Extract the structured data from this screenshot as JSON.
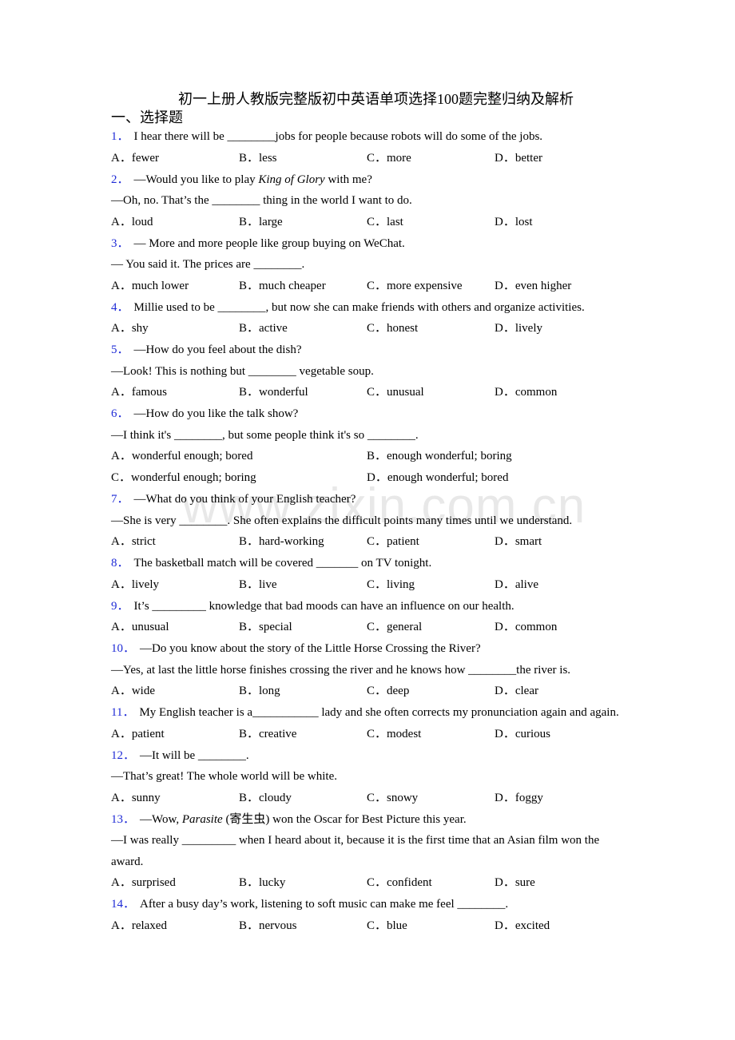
{
  "document": {
    "title": "初一上册人教版完整版初中英语单项选择100题完整归纳及解析",
    "section_heading": "一、选择题",
    "watermark": "www.zixin.com.cn",
    "accent_color": "#1f2bd6"
  },
  "questions": [
    {
      "number": "1．",
      "lines": [
        "I hear there will be ________jobs for people because robots will do some of the jobs."
      ],
      "options": [
        "A．fewer",
        "B．less",
        "C．more",
        "D．better"
      ]
    },
    {
      "number": "2．",
      "line1_pre": "—Would you like to play ",
      "line1_italic": "King of Glory",
      "line1_post": " with me?",
      "lines": [
        "—Oh, no. That’s the ________ thing in the world I want to do."
      ],
      "options": [
        "A．loud",
        "B．large",
        "C．last",
        "D．lost"
      ]
    },
    {
      "number": "3．",
      "lines": [
        "— More and more people like group buying on WeChat.",
        "— You said it. The prices are ________."
      ],
      "options": [
        "A．much lower",
        "B．much cheaper",
        "C．more expensive",
        "D．even higher"
      ]
    },
    {
      "number": "4．",
      "lines": [
        "Millie used to be ________, but now she can make friends with others and organize activities."
      ],
      "options": [
        "A．shy",
        "B．active",
        "C．honest",
        "D．lively"
      ]
    },
    {
      "number": "5．",
      "lines": [
        "—How do you feel about the dish?",
        "—Look! This is nothing but ________ vegetable soup."
      ],
      "options": [
        "A．famous",
        "B．wonderful",
        "C．unusual",
        "D．common"
      ]
    },
    {
      "number": "6．",
      "lines": [
        "—How do you like the talk show?",
        "—I think it's ________, but some people think it's so ________."
      ],
      "options": [
        "A．wonderful enough; bored",
        "B．enough wonderful; boring",
        "C．wonderful enough; boring",
        "D．enough wonderful; bored"
      ]
    },
    {
      "number": "7．",
      "lines": [
        "—What do you think of your English teacher?",
        "—She is very ________. She often explains the difficult points many times until we understand."
      ],
      "options": [
        "A．strict",
        "B．hard-working",
        "C．patient",
        "D．smart"
      ]
    },
    {
      "number": "8．",
      "lines": [
        "The basketball match will be covered _______ on TV tonight."
      ],
      "options": [
        "A．lively",
        "B．live",
        "C．living",
        "D．alive"
      ]
    },
    {
      "number": "9．",
      "lines": [
        "It’s _________ knowledge that bad moods can have an influence on our health."
      ],
      "options": [
        "A．unusual",
        "B．special",
        "C．general",
        "D．common"
      ]
    },
    {
      "number": "10．",
      "lines": [
        "—Do you know about the story of the Little Horse Crossing the River?",
        "—Yes, at last the little horse finishes crossing the river and he knows how ________the river is."
      ],
      "options": [
        "A．wide",
        "B．long",
        "C．deep",
        "D．clear"
      ]
    },
    {
      "number": "11．",
      "lines": [
        "My English teacher is a___________ lady and she often corrects my pronunciation again and again."
      ],
      "options": [
        "A．patient",
        "B．creative",
        "C．modest",
        "D．curious"
      ]
    },
    {
      "number": "12．",
      "lines": [
        "—It will be ________.",
        "—That’s great! The whole world will be white."
      ],
      "options": [
        "A．sunny",
        "B．cloudy",
        "C．snowy",
        "D．foggy"
      ]
    },
    {
      "number": "13．",
      "line1_pre": "—Wow, ",
      "line1_italic": "Parasite",
      "line1_post": " (寄生虫) won the Oscar for Best Picture this year.",
      "lines": [
        "—I was really _________ when I heard about it, because it is the first time that an Asian film won the award."
      ],
      "options": [
        "A．surprised",
        "B．lucky",
        "C．confident",
        "D．sure"
      ]
    },
    {
      "number": "14．",
      "lines": [
        "After a busy day’s work, listening to soft music can make me feel ________."
      ],
      "options": [
        "A．relaxed",
        "B．nervous",
        "C．blue",
        "D．excited"
      ]
    }
  ]
}
